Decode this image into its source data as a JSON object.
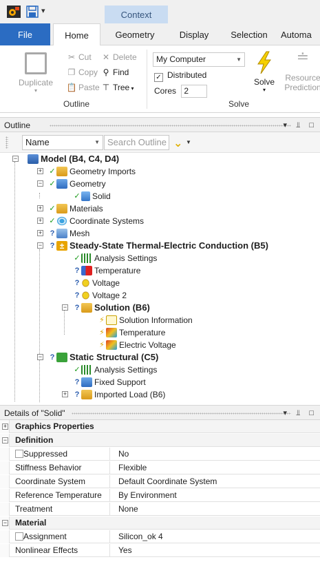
{
  "quick_access": {
    "context_tab": "Context",
    "dropdown_glyph": "▾"
  },
  "ribbon_tabs": [
    {
      "label": "File"
    },
    {
      "label": "Home"
    },
    {
      "label": "Geometry"
    },
    {
      "label": "Display"
    },
    {
      "label": "Selection"
    },
    {
      "label": "Automa"
    }
  ],
  "ribbon": {
    "outline_group": {
      "duplicate": "Duplicate",
      "cut": "Cut",
      "copy": "Copy",
      "paste": "Paste",
      "delete": "Delete",
      "find": "Find",
      "tree": "Tree",
      "label": "Outline"
    },
    "solve_group": {
      "target": "My Computer",
      "distributed_label": "Distributed",
      "distributed_checked": true,
      "cores_label": "Cores",
      "cores_value": "2",
      "solve": "Solve",
      "resource_prediction_1": "Resource",
      "resource_prediction_2": "Prediction",
      "label": "Solve"
    }
  },
  "outline_panel": {
    "title": "Outline",
    "pin_glyph": "▾ ⫫ □",
    "name_filter": "Name",
    "search_placeholder": "Search Outline"
  },
  "tree": [
    {
      "label": "Model (B4, C4, D4)",
      "bold": true,
      "expander": "−"
    },
    {
      "label": "Geometry Imports",
      "status": "✓",
      "expander": "+"
    },
    {
      "label": "Geometry",
      "status": "✓",
      "expander": "−"
    },
    {
      "label": "Solid",
      "status": "✓"
    },
    {
      "label": "Materials",
      "status": "✓",
      "expander": "+"
    },
    {
      "label": "Coordinate Systems",
      "status": "✓",
      "expander": "+"
    },
    {
      "label": "Mesh",
      "status": "?",
      "expander": "+"
    },
    {
      "label": "Steady-State Thermal-Electric Conduction (B5)",
      "bold": true,
      "status": "?",
      "expander": "−"
    },
    {
      "label": "Analysis Settings",
      "status": "✓"
    },
    {
      "label": "Temperature",
      "status": "?"
    },
    {
      "label": "Voltage",
      "status": "?"
    },
    {
      "label": "Voltage 2",
      "status": "?"
    },
    {
      "label": "Solution (B6)",
      "bold": true,
      "status": "?",
      "expander": "−"
    },
    {
      "label": "Solution Information",
      "status": "⚡"
    },
    {
      "label": "Temperature",
      "status": "⚡"
    },
    {
      "label": "Electric Voltage",
      "status": "⚡"
    },
    {
      "label": "Static Structural (C5)",
      "bold": true,
      "status": "?",
      "expander": "−"
    },
    {
      "label": "Analysis Settings",
      "status": "✓"
    },
    {
      "label": "Fixed Support",
      "status": "?"
    },
    {
      "label": "Imported Load (B6)",
      "status": "?",
      "expander": "+"
    }
  ],
  "details_panel": {
    "title": "Details of \"Solid\"",
    "pin_glyph": "▾ ⫫ □",
    "sections": {
      "graphics": "Graphics Properties",
      "definition": "Definition",
      "material": "Material"
    },
    "rows": {
      "suppressed": {
        "key": "Suppressed",
        "value": "No"
      },
      "stiffness": {
        "key": "Stiffness Behavior",
        "value": "Flexible"
      },
      "coord": {
        "key": "Coordinate System",
        "value": "Default Coordinate System"
      },
      "reftemp": {
        "key": "Reference Temperature",
        "value": "By Environment"
      },
      "treatment": {
        "key": "Treatment",
        "value": "None"
      },
      "assignment": {
        "key": "Assignment",
        "value": "Silicon_ok 4"
      },
      "nonlinear": {
        "key": "Nonlinear Effects",
        "value": "Yes"
      }
    }
  }
}
